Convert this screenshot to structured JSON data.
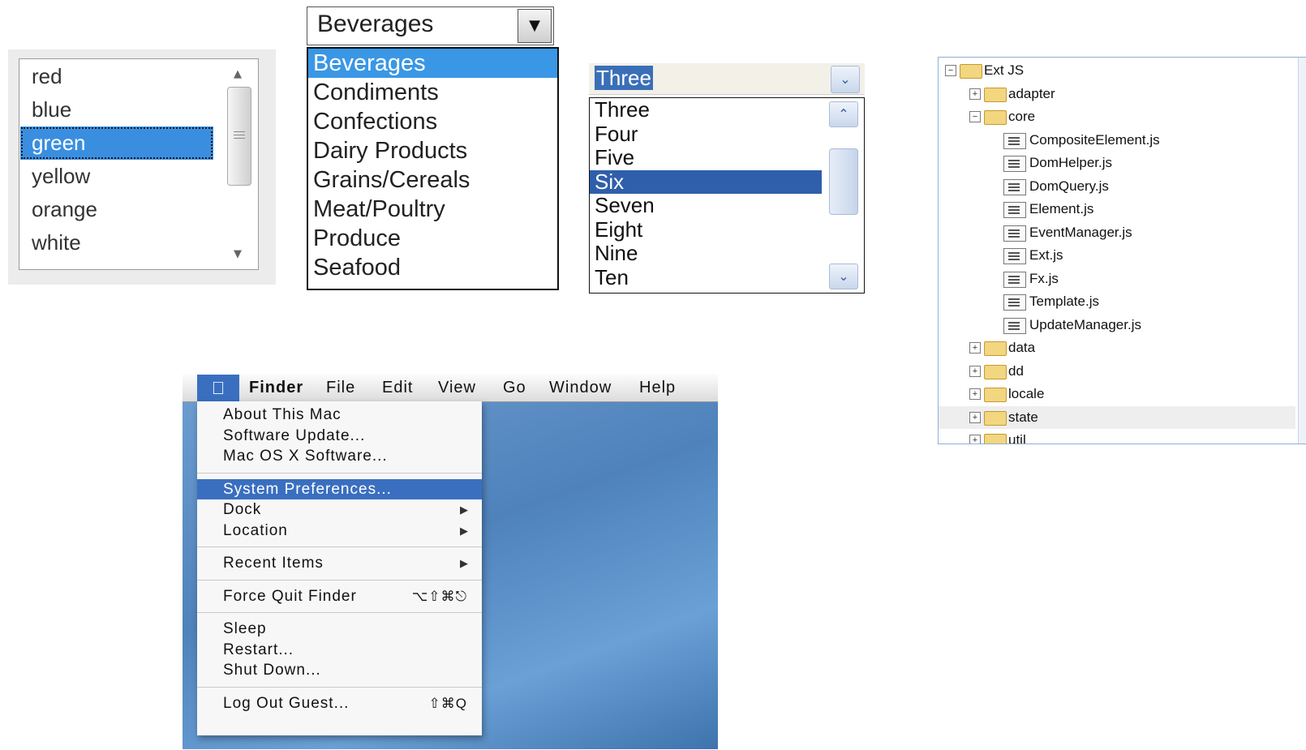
{
  "listbox": {
    "items": [
      "red",
      "blue",
      "green",
      "yellow",
      "orange",
      "white"
    ],
    "selected": "green"
  },
  "combo": {
    "value": "Beverages",
    "options": [
      "Beverages",
      "Condiments",
      "Confections",
      "Dairy Products",
      "Grains/Cereals",
      "Meat/Poultry",
      "Produce",
      "Seafood"
    ],
    "selected": "Beverages"
  },
  "select": {
    "value": "Three",
    "options": [
      "Three",
      "Four",
      "Five",
      "Six",
      "Seven",
      "Eight",
      "Nine",
      "Ten"
    ],
    "selected": "Six"
  },
  "mac": {
    "menubar": [
      "Finder",
      "File",
      "Edit",
      "View",
      "Go",
      "Window",
      "Help"
    ],
    "apple_icon": "apple-icon",
    "menu_groups": [
      [
        {
          "label": "About This Mac"
        },
        {
          "label": "Software Update..."
        },
        {
          "label": "Mac OS X Software..."
        }
      ],
      [
        {
          "label": "System Preferences...",
          "highlighted": true
        },
        {
          "label": "Dock",
          "submenu": true
        },
        {
          "label": "Location",
          "submenu": true
        }
      ],
      [
        {
          "label": "Recent Items",
          "submenu": true
        }
      ],
      [
        {
          "label": "Force Quit Finder",
          "shortcut": "⌥⇧⌘⎋"
        }
      ],
      [
        {
          "label": "Sleep"
        },
        {
          "label": "Restart..."
        },
        {
          "label": "Shut Down..."
        }
      ],
      [
        {
          "label": "Log Out Guest...",
          "shortcut": "⇧⌘Q"
        }
      ]
    ],
    "colors": {
      "highlight": "#3a6fc0",
      "desktop": "#5a8cc6"
    }
  },
  "tree": {
    "root": "Ext JS",
    "nodes": [
      {
        "label": "adapter",
        "type": "folder",
        "state": "collapsed",
        "level": 1
      },
      {
        "label": "core",
        "type": "folder",
        "state": "expanded",
        "level": 1
      },
      {
        "label": "CompositeElement.js",
        "type": "file",
        "level": 2
      },
      {
        "label": "DomHelper.js",
        "type": "file",
        "level": 2
      },
      {
        "label": "DomQuery.js",
        "type": "file",
        "level": 2
      },
      {
        "label": "Element.js",
        "type": "file",
        "level": 2
      },
      {
        "label": "EventManager.js",
        "type": "file",
        "level": 2
      },
      {
        "label": "Ext.js",
        "type": "file",
        "level": 2
      },
      {
        "label": "Fx.js",
        "type": "file",
        "level": 2
      },
      {
        "label": "Template.js",
        "type": "file",
        "level": 2
      },
      {
        "label": "UpdateManager.js",
        "type": "file",
        "level": 2
      },
      {
        "label": "data",
        "type": "folder",
        "state": "collapsed",
        "level": 1
      },
      {
        "label": "dd",
        "type": "folder",
        "state": "collapsed",
        "level": 1
      },
      {
        "label": "locale",
        "type": "folder",
        "state": "collapsed",
        "level": 1
      },
      {
        "label": "state",
        "type": "folder",
        "state": "collapsed",
        "level": 1,
        "highlighted": true
      },
      {
        "label": "util",
        "type": "folder",
        "state": "collapsed",
        "level": 1
      }
    ]
  }
}
